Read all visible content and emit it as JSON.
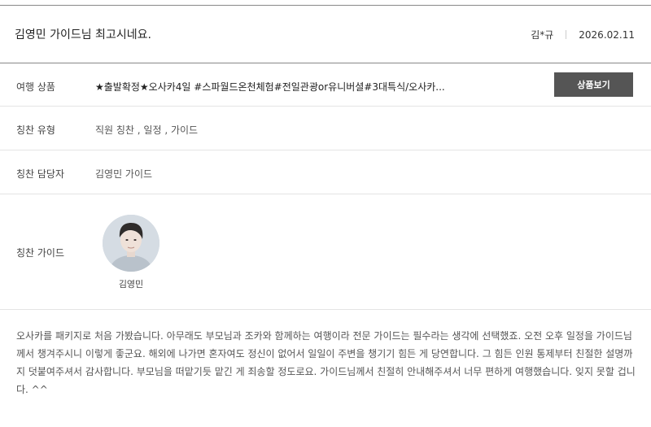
{
  "review": {
    "title": "김영민 가이드님 최고시네요.",
    "author": "김*규",
    "date": "2026.02.11"
  },
  "details": {
    "product_label": "여행 상품",
    "product_value": "★출발확정★오사카4일 #스파월드온천체험#전일관광or유니버셜#3대특식/오사카...",
    "product_button": "상품보기",
    "type_label": "칭찬 유형",
    "type_value": "직원 칭찬 , 일정 , 가이드",
    "manager_label": "칭찬 담당자",
    "manager_value": "김영민 가이드",
    "guide_label": "칭찬 가이드",
    "guide_name": "김영민"
  },
  "content": {
    "text": "오사카를 패키지로 처음 가봤습니다. 아무래도 부모님과 조카와 함께하는 여행이라 전문 가이드는 필수라는 생각에 선택했죠. 오전 오후 일정을 가이드님께서 챙겨주시니 이렇게 좋군요. 해외에 나가면 혼자여도 정신이 없어서 일일이 주변을 챙기기 힘든 게 당연합니다. 그 힘든 인원 통제부터 친절한 설명까지 덧붙여주셔서 감사합니다. 부모님을 떠맡기듯 맡긴 게 죄송할 정도로요. 가이드님께서 친절히 안내해주셔서 너무 편하게 여행했습니다. 잊지 못할 겁니다. ^^"
  },
  "icons": {
    "avatar": "guide-portrait"
  }
}
